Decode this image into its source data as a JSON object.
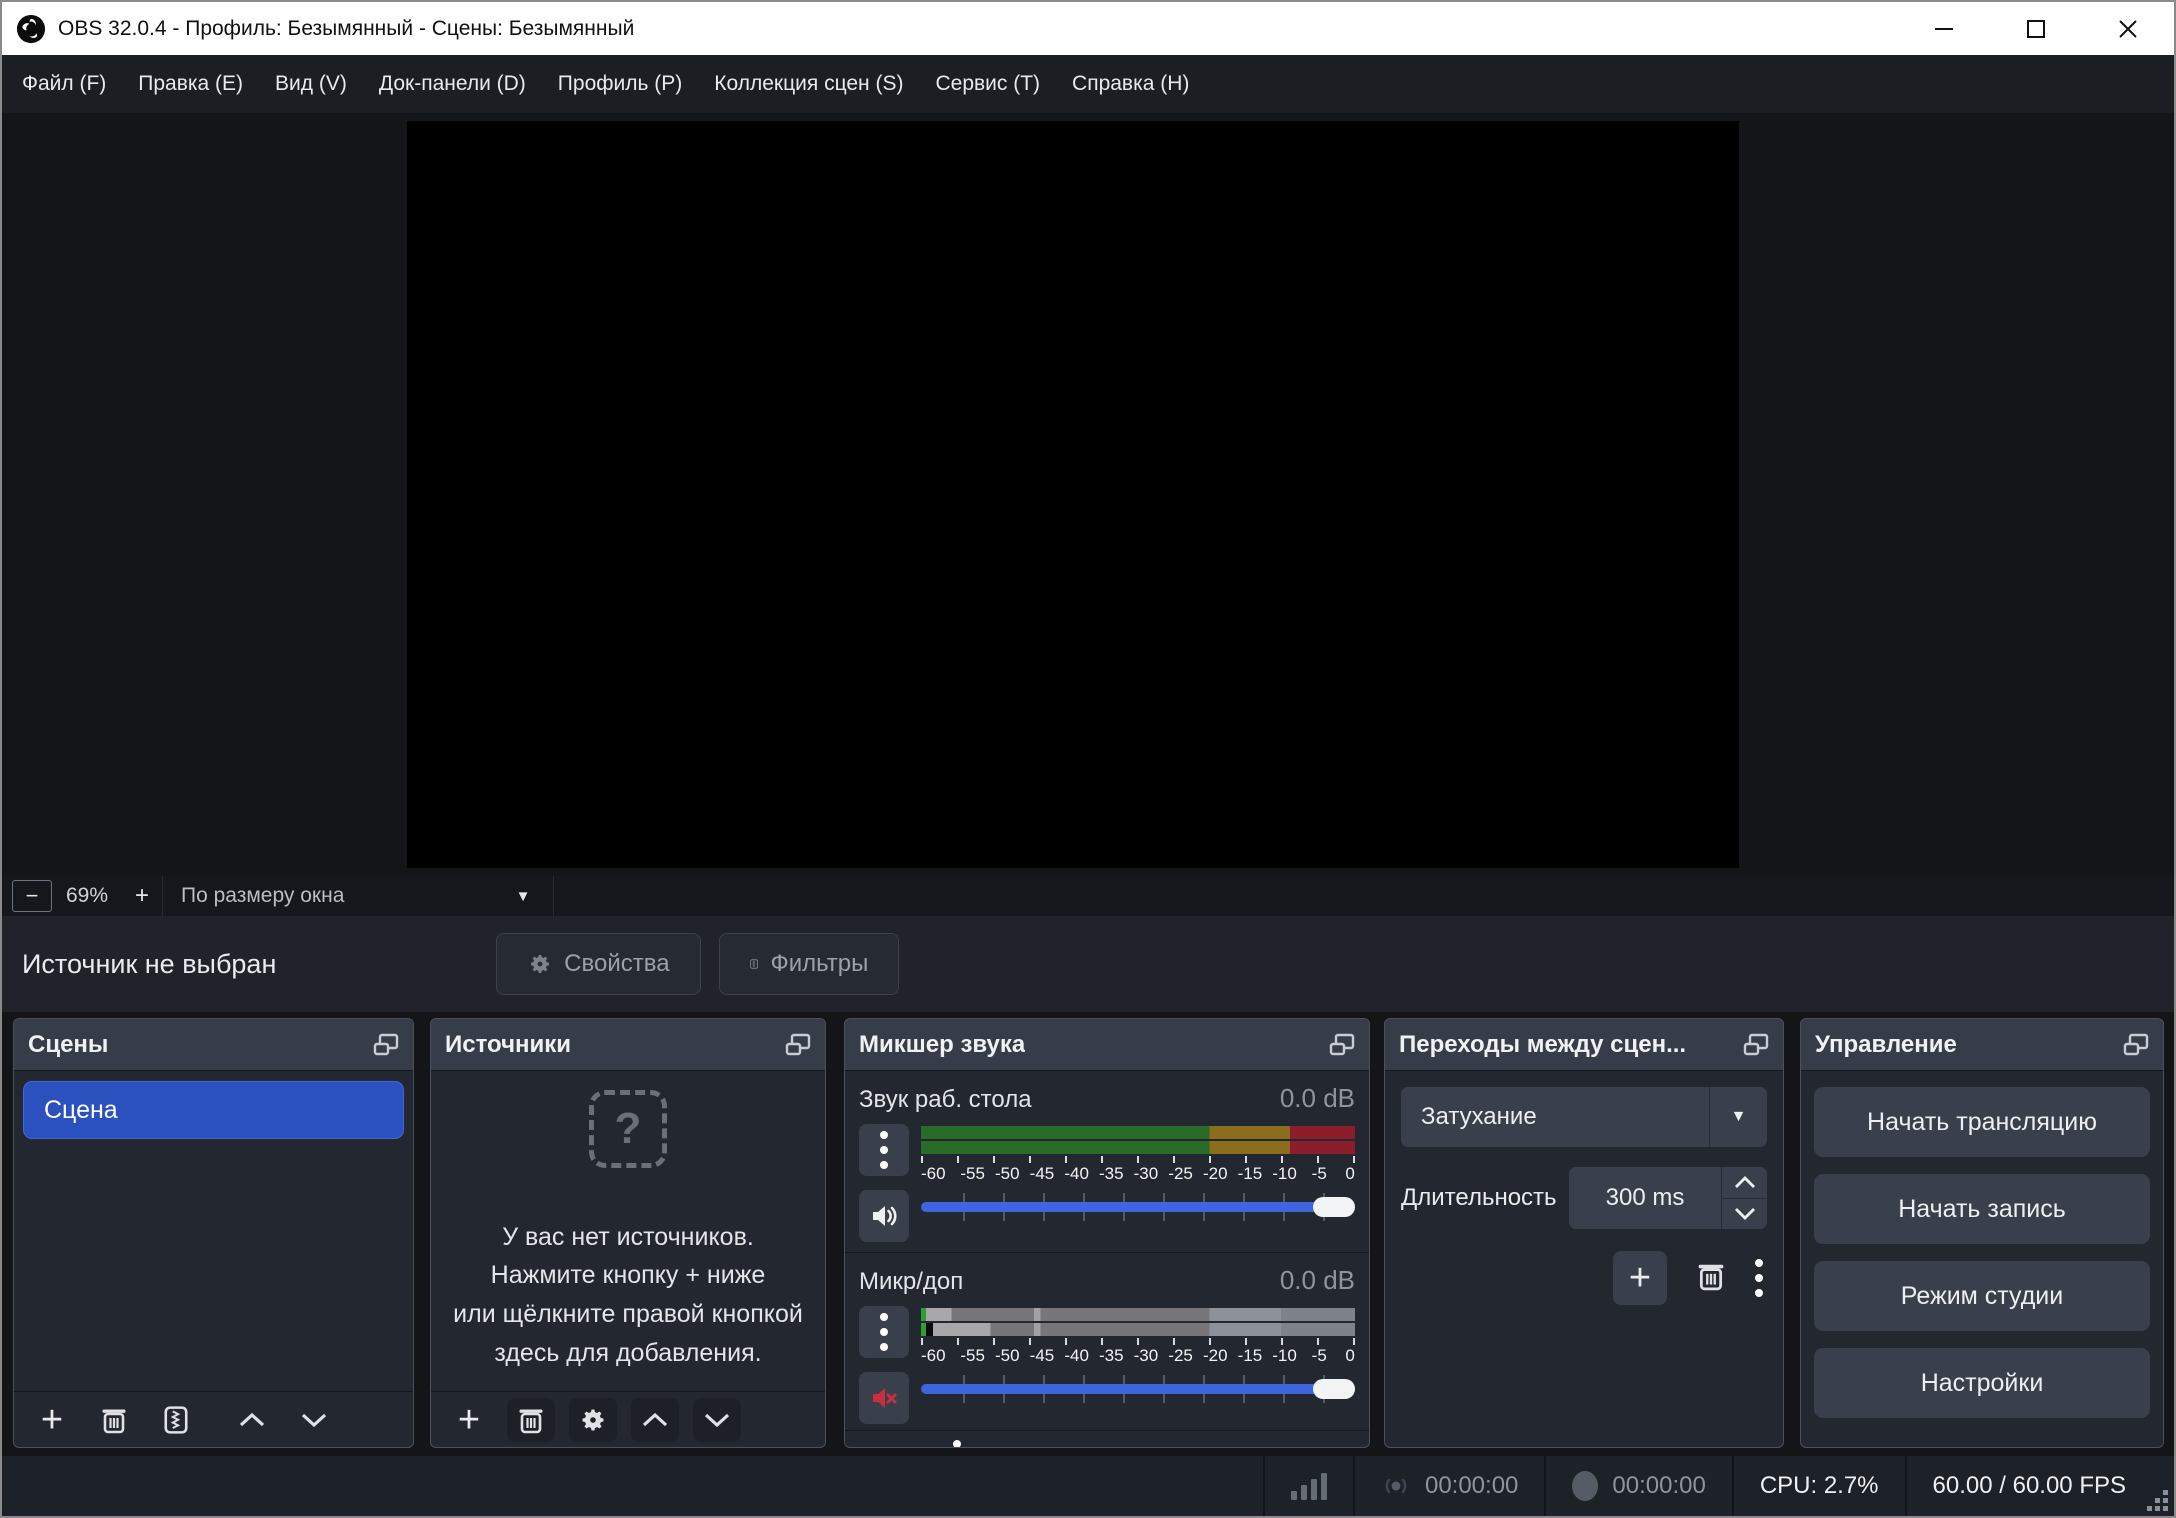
{
  "window": {
    "title": "OBS 32.0.4 - Профиль: Безымянный - Сцены: Безымянный"
  },
  "menu": {
    "items": [
      "Файл (F)",
      "Правка (E)",
      "Вид (V)",
      "Док-панели (D)",
      "Профиль (P)",
      "Коллекция сцен (S)",
      "Сервис (T)",
      "Справка (H)"
    ]
  },
  "preview": {
    "zoom_out_label": "−",
    "zoom_level": "69%",
    "zoom_in_label": "+",
    "fit_mode": "По размеру окна",
    "dropdown_arrow": "▼"
  },
  "source_row": {
    "status": "Источник не выбран",
    "properties_label": "Свойства",
    "filters_label": "Фильтры"
  },
  "scenes": {
    "title": "Сцены",
    "items": [
      {
        "label": "Сцена",
        "selected": true
      }
    ]
  },
  "sources": {
    "title": "Источники",
    "empty_icon_glyph": "?",
    "empty_lines": [
      "У вас нет источников.",
      "Нажмите кнопку + ниже",
      "или щёлкните правой кнопкой",
      "здесь для добавления."
    ]
  },
  "mixer": {
    "title": "Микшер звука",
    "channels": [
      {
        "name": "Звук раб. стола",
        "level": "0.0 dB",
        "muted": false
      },
      {
        "name": "Микр/доп",
        "level": "0.0 dB",
        "muted": true
      }
    ],
    "scale": [
      "-60",
      "-55",
      "-50",
      "-45",
      "-40",
      "-35",
      "-30",
      "-25",
      "-20",
      "-15",
      "-10",
      "-5",
      "0"
    ]
  },
  "transitions": {
    "title": "Переходы между сцен...",
    "transition_value": "Затухание",
    "dropdown_arrow": "▼",
    "duration_label": "Длительность",
    "duration_value": "300 ms",
    "add_label": "+"
  },
  "controls": {
    "title": "Управление",
    "buttons": [
      "Начать трансляцию",
      "Начать запись",
      "Режим студии",
      "Настройки"
    ]
  },
  "status": {
    "stream_time": "00:00:00",
    "record_time": "00:00:00",
    "cpu": "CPU: 2.7%",
    "fps": "60.00 / 60.00 FPS"
  },
  "toolbar_labels": {
    "plus": "+"
  },
  "colors": {
    "accent_selection": "#2b51bf",
    "slider_blue": "#3e64de",
    "meter_green": "#2a6b2a",
    "meter_yellow": "#8a6d1d",
    "meter_red": "#8c1e2c",
    "mute_red": "#c4303e"
  }
}
